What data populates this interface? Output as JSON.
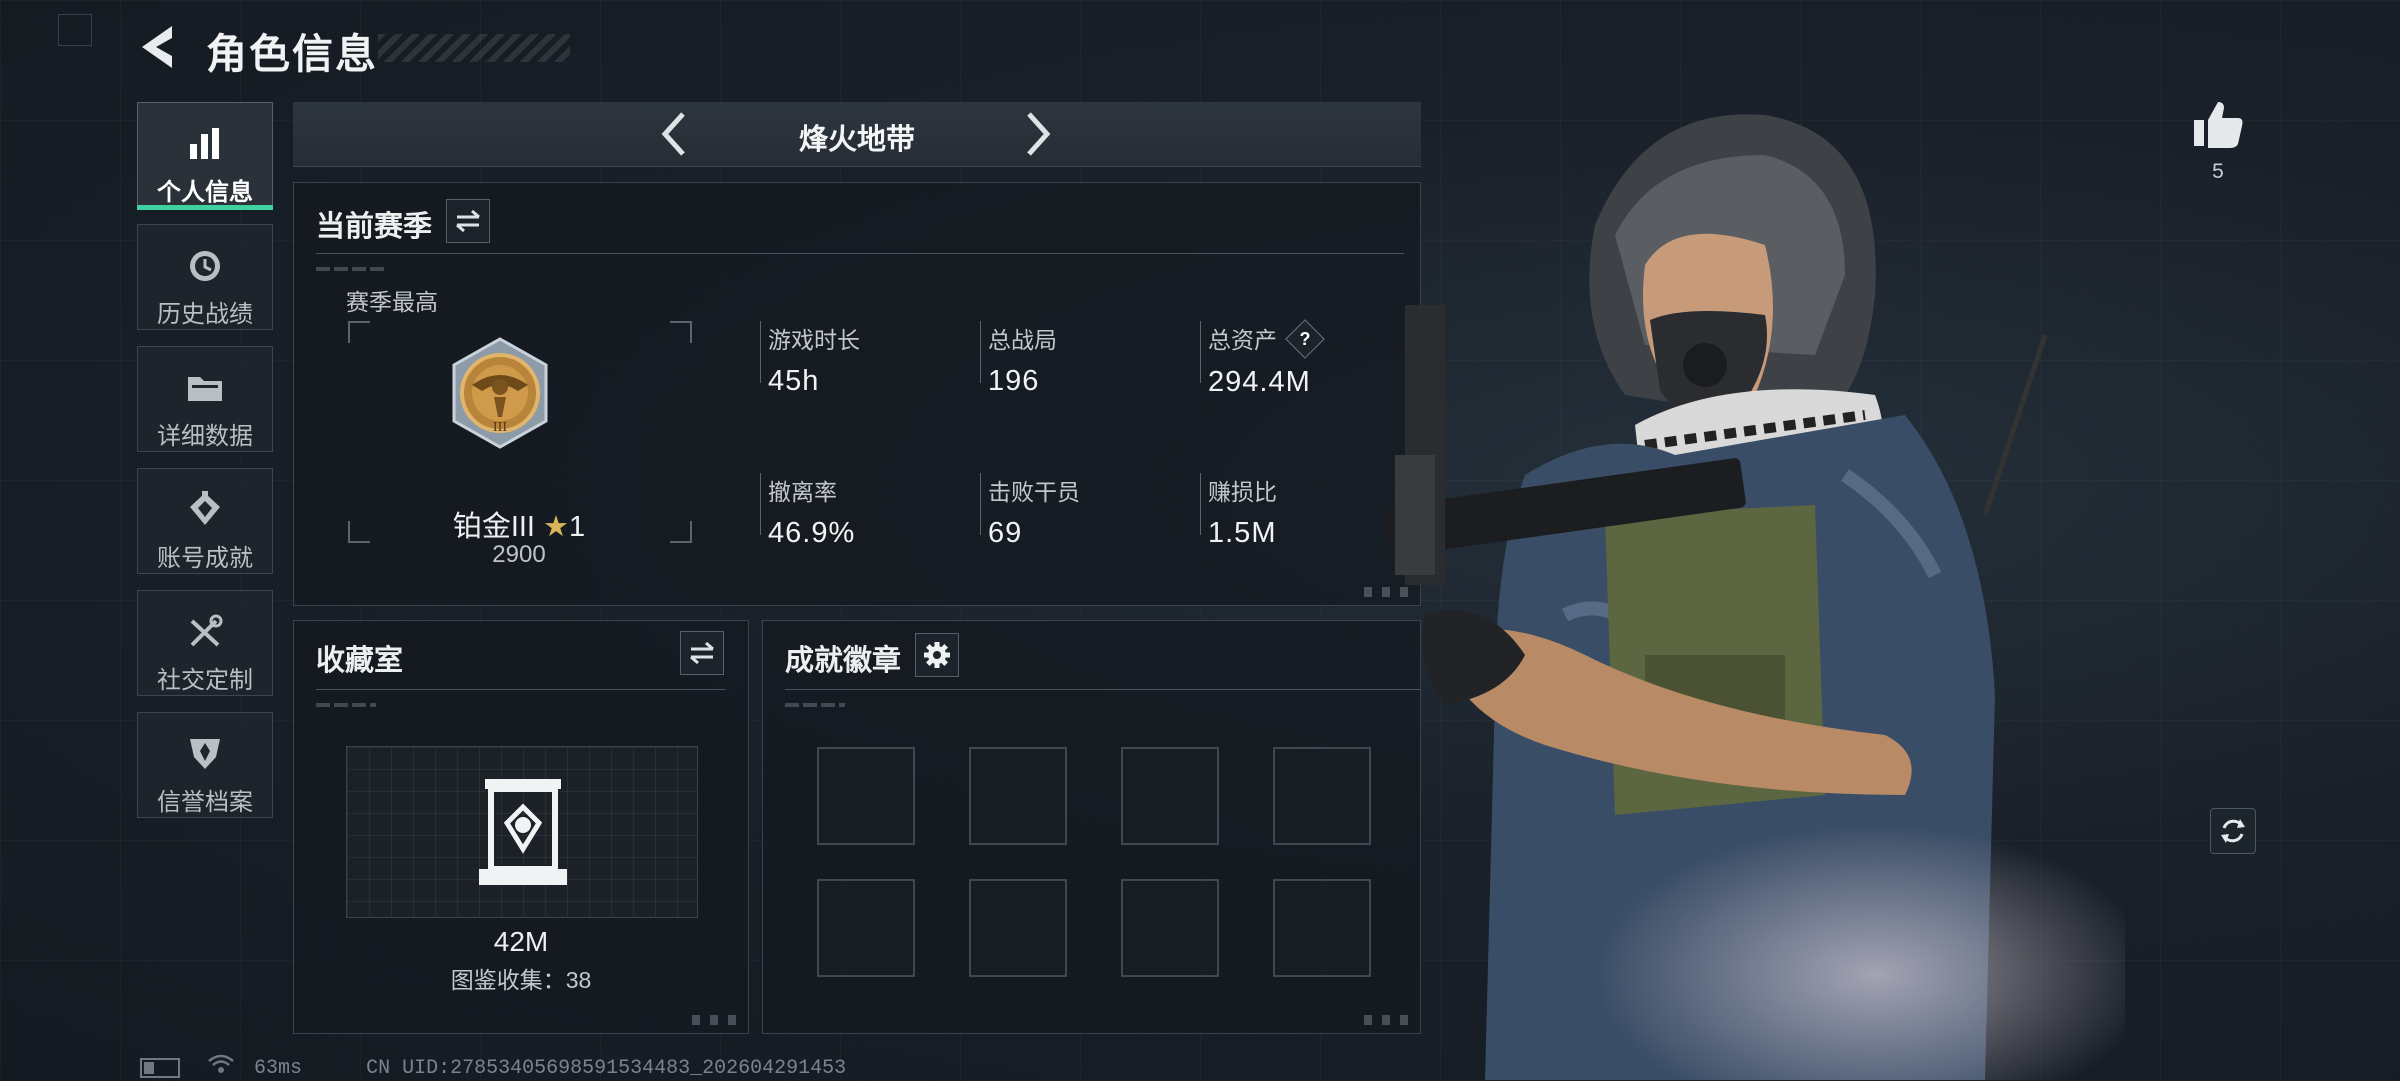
{
  "header": {
    "title": "角色信息",
    "back_icon": "back-arrow-icon"
  },
  "sidebar": {
    "items": [
      {
        "label": "个人信息",
        "icon": "bar-chart-icon",
        "active": true
      },
      {
        "label": "历史战绩",
        "icon": "clock-icon",
        "active": false
      },
      {
        "label": "详细数据",
        "icon": "folder-icon",
        "active": false
      },
      {
        "label": "账号成就",
        "icon": "trophy-icon",
        "active": false
      },
      {
        "label": "社交定制",
        "icon": "tools-icon",
        "active": false
      },
      {
        "label": "信誉档案",
        "icon": "shield-icon",
        "active": false
      }
    ]
  },
  "mode_selector": {
    "title": "烽火地带"
  },
  "season": {
    "title": "当前赛季",
    "best_label": "赛季最高",
    "rank_name": "铂金III",
    "rank_stars": "1",
    "rank_score": "2900",
    "stats": [
      {
        "label": "游戏时长",
        "value": "45h"
      },
      {
        "label": "总战局",
        "value": "196"
      },
      {
        "label": "总资产",
        "value": "294.4M",
        "help": "?"
      },
      {
        "label": "撤离率",
        "value": "46.9%"
      },
      {
        "label": "击败干员",
        "value": "69"
      },
      {
        "label": "赚损比",
        "value": "1.5M"
      }
    ]
  },
  "collection": {
    "title": "收藏室",
    "value": "42M",
    "sub_label": "图鉴收集：38"
  },
  "achievements": {
    "title": "成就徽章",
    "slot_count": 8
  },
  "social": {
    "like_count": "5"
  },
  "footer": {
    "ping": "63ms",
    "uid": "CN UID:27853405698591534483_202604291453"
  },
  "colors": {
    "accent": "#3fd2a0",
    "background": "#1a2029",
    "panel_border": "#3a444e"
  }
}
